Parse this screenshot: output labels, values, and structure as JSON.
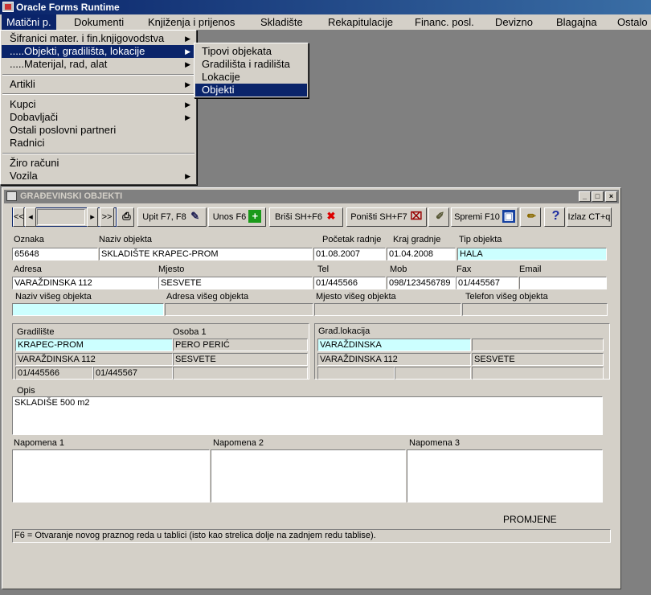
{
  "app": {
    "title": "Oracle Forms Runtime"
  },
  "menubar": [
    "Matični p.",
    "Dokumenti",
    "Knjiženja i prijenos",
    "Skladište",
    "Rekapitulacije",
    "Financ. posl.",
    "Devizno",
    "Blagajna",
    "Ostalo"
  ],
  "main_menu": {
    "items": [
      {
        "label": "Šifranici mater. i fin.knjigovodstva",
        "submenu": true
      },
      {
        "label": ".....Objekti, gradilišta, lokacije",
        "submenu": true,
        "selected": true
      },
      {
        "label": ".....Materijal, rad, alat",
        "submenu": true
      },
      {
        "label": "Artikli",
        "submenu": true
      },
      {
        "label": "Kupci",
        "submenu": true
      },
      {
        "label": "Dobavljači",
        "submenu": true
      },
      {
        "label": "Ostali poslovni partneri",
        "submenu": false
      },
      {
        "label": "Radnici",
        "submenu": false
      },
      {
        "label": "Žiro računi",
        "submenu": false
      },
      {
        "label": "Vozila",
        "submenu": true
      }
    ]
  },
  "sub_menu": {
    "items": [
      {
        "label": "Tipovi objekata",
        "selected": false
      },
      {
        "label": "Gradilišta i radilišta",
        "selected": false
      },
      {
        "label": "Lokacije",
        "selected": false
      },
      {
        "label": "Objekti",
        "selected": true
      }
    ]
  },
  "form": {
    "title": "GRAĐEVINSKI OBJEKTI",
    "toolbar": {
      "nav_first": "<<",
      "nav_prev": "◂",
      "nav_next": "▸",
      "nav_last": ">>",
      "query": "Upit F7, F8",
      "insert": "Unos F6",
      "delete": "Briši  SH+F6",
      "cancel": "Poništi SH+F7",
      "save": "Spremi F10",
      "exit": "Izlaz CT+q",
      "help": "?"
    },
    "labels": {
      "oznaka": "Oznaka",
      "naziv": "Naziv objekta",
      "pocetak": "Početak radnje",
      "kraj": "Kraj gradnje",
      "tip": "Tip objekta",
      "adresa": "Adresa",
      "mjesto": "Mjesto",
      "tel": "Tel",
      "mob": "Mob",
      "fax": "Fax",
      "email": "Email",
      "naziv_viseg": "Naziv višeg objekta",
      "adresa_viseg": "Adresa višeg objekta",
      "mjesto_viseg": "Mjesto višeg objekta",
      "telefon_viseg": "Telefon višeg objekta",
      "gradiliste": "Gradilište",
      "osoba1": "Osoba 1",
      "grad_lokacija": "Građ.lokacija",
      "opis": "Opis",
      "napomena1": "Napomena 1",
      "napomena2": "Napomena 2",
      "napomena3": "Napomena 3",
      "promjene": "PROMJENE"
    },
    "values": {
      "oznaka": "65648",
      "naziv": "SKLADIŠTE KRAPEC-PROM",
      "pocetak": "01.08.2007",
      "kraj": "01.04.2008",
      "tip": "HALA",
      "adresa": "VARAŽDINSKA 112",
      "mjesto": "SESVETE",
      "tel": "01/445566",
      "mob": "098/123456789",
      "fax": "01/445567",
      "email": "",
      "naziv_viseg": "",
      "adresa_viseg": "",
      "mjesto_viseg": "",
      "telefon_viseg": "",
      "gradiliste_naziv": "KRAPEC-PROM",
      "gradiliste_adresa": "VARAŽDINSKA 112",
      "gradiliste_tel": "01/445566",
      "gradiliste_fax": "01/445567",
      "osoba1": "PERO PERIĆ",
      "osoba1_mjesto": "SESVETE",
      "lokacija_naziv": "VARAŽDINSKA",
      "lokacija_adresa": "VARAŽDINSKA 112",
      "lokacija_mjesto": "SESVETE",
      "opis": "SKLADIŠE 500 m2",
      "napomena1": "",
      "napomena2": "",
      "napomena3": ""
    },
    "status": "F6 = Otvaranje novog praznog reda u tablici (isto kao strelica dolje na zadnjem redu tablise)."
  },
  "colors": {
    "title_blue": "#0a246a",
    "menu_bg": "#d4d0c8",
    "desktop": "#808080",
    "query_field": "#ccffff"
  }
}
